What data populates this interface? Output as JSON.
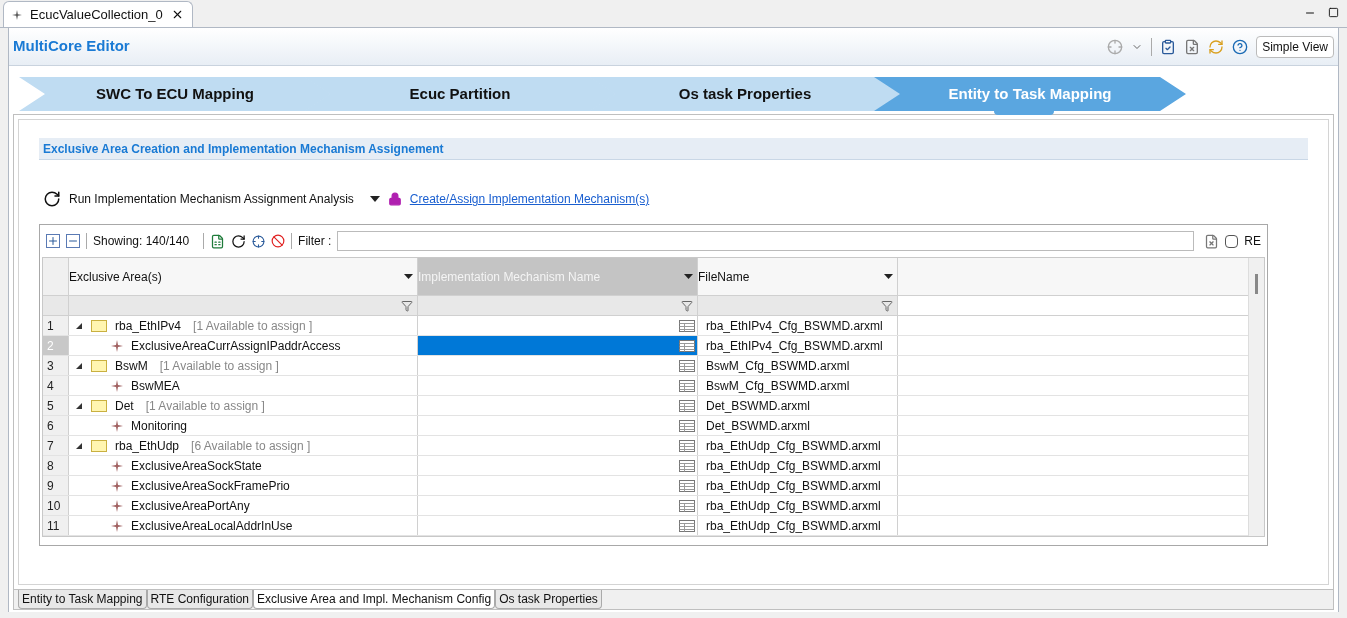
{
  "editor_tab": {
    "title": "EcucValueCollection_0"
  },
  "header": {
    "title": "MultiCore Editor",
    "simple_view_button": "Simple View"
  },
  "steps": [
    {
      "label": "SWC To ECU Mapping",
      "selected": false
    },
    {
      "label": "Ecuc Partition",
      "selected": false
    },
    {
      "label": "Os task Properties",
      "selected": false
    },
    {
      "label": "Entity to Task Mapping",
      "selected": true
    }
  ],
  "section": {
    "title": "Exclusive Area Creation and Implementation Mechanism Assignement"
  },
  "actions": {
    "run_analysis": "Run Implementation Mechanism Assignment Analysis",
    "create_link": "Create/Assign Implementation Mechanism(s)"
  },
  "toolbar": {
    "showing": "Showing: 140/140",
    "filter_label": "Filter :",
    "regex_label": "RE",
    "regex_checked": false
  },
  "table": {
    "columns": [
      {
        "label": "Exclusive Area(s)",
        "selected": false
      },
      {
        "label": "Implementation Mechanism Name",
        "selected": true
      },
      {
        "label": "FileName",
        "selected": false
      }
    ],
    "rows": [
      {
        "number": "1",
        "name": "rba_EthIPv4",
        "hint": "[1 Available to assign ]",
        "file": "rba_EthIPv4_Cfg_BSWMD.arxml",
        "selected": false,
        "expanded": true,
        "children": [
          {
            "number": "2",
            "name": "ExclusiveAreaCurrAssignIPaddrAccess",
            "file": "rba_EthIPv4_Cfg_BSWMD.arxml",
            "selected": true
          }
        ]
      },
      {
        "number": "3",
        "name": "BswM",
        "hint": "[1 Available to assign ]",
        "file": "BswM_Cfg_BSWMD.arxml",
        "selected": false,
        "expanded": true,
        "children": [
          {
            "number": "4",
            "name": "BswMEA",
            "file": "BswM_Cfg_BSWMD.arxml",
            "selected": false
          }
        ]
      },
      {
        "number": "5",
        "name": "Det",
        "hint": "[1 Available to assign ]",
        "file": "Det_BSWMD.arxml",
        "selected": false,
        "expanded": true,
        "children": [
          {
            "number": "6",
            "name": "Monitoring",
            "file": "Det_BSWMD.arxml",
            "selected": false
          }
        ]
      },
      {
        "number": "7",
        "name": "rba_EthUdp",
        "hint": "[6 Available to assign ]",
        "file": "rba_EthUdp_Cfg_BSWMD.arxml",
        "selected": false,
        "expanded": true,
        "children": [
          {
            "number": "8",
            "name": "ExclusiveAreaSockState",
            "file": "rba_EthUdp_Cfg_BSWMD.arxml",
            "selected": false
          },
          {
            "number": "9",
            "name": "ExclusiveAreaSockFramePrio",
            "file": "rba_EthUdp_Cfg_BSWMD.arxml",
            "selected": false
          },
          {
            "number": "10",
            "name": "ExclusiveAreaPortAny",
            "file": "rba_EthUdp_Cfg_BSWMD.arxml",
            "selected": false
          },
          {
            "number": "11",
            "name": "ExclusiveAreaLocalAddrInUse",
            "file": "rba_EthUdp_Cfg_BSWMD.arxml",
            "selected": false
          }
        ]
      }
    ]
  },
  "bottom_tabs": [
    {
      "label": "Entity to Task Mapping",
      "selected": false
    },
    {
      "label": "RTE Configuration",
      "selected": false
    },
    {
      "label": "Exclusive Area and Impl. Mechanism Config",
      "selected": true
    },
    {
      "label": "Os task Properties",
      "selected": false
    }
  ]
}
